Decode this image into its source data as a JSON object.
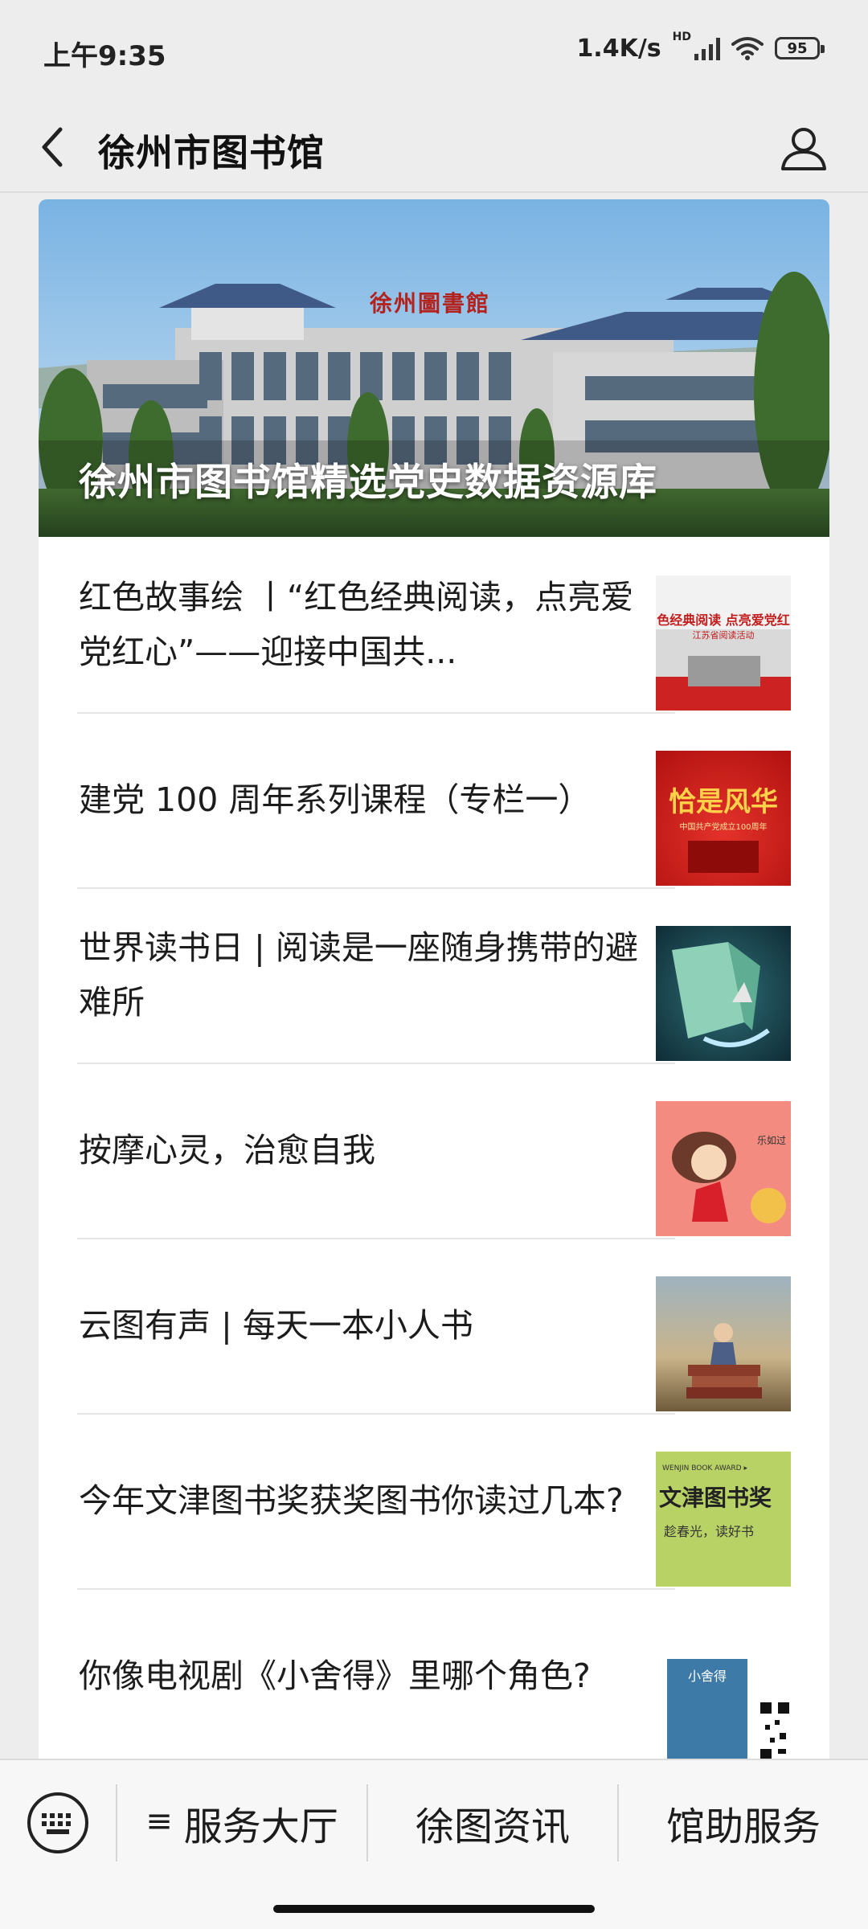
{
  "status_bar": {
    "time": "上午9:35",
    "network_speed": "1.4K/s",
    "network_type": "HD",
    "battery": "95"
  },
  "header": {
    "title": "徐州市图书馆",
    "back_icon": "chevron-left-icon",
    "profile_icon": "user-icon"
  },
  "hero": {
    "title": "徐州市图书馆精选党史数据资源库",
    "sign_text": "徐州圖書館"
  },
  "articles": [
    {
      "title": "红色故事绘 丨“红色经典阅读，点亮爱党红心”——迎接中国共...",
      "thumb": "red-classic-reading-image",
      "thumb_text": "色经典阅读 点亮爱党红",
      "thumb_sub": "江苏省阅读活动"
    },
    {
      "title": "建党 100 周年系列课程（专栏一）",
      "thumb": "party-centenary-image",
      "thumb_text": "恰是风华",
      "thumb_sub": "中国共产党成立100周年"
    },
    {
      "title": "世界读书日 | 阅读是一座随身携带的避难所",
      "thumb": "open-book-ship-image"
    },
    {
      "title": "按摩心灵，治愈自我",
      "thumb": "cartoon-illustration-image",
      "thumb_text": "乐如过"
    },
    {
      "title": "云图有声 | 每天一本小人书",
      "thumb": "girl-on-books-image"
    },
    {
      "title": "今年文津图书奖获奖图书你读过几本?",
      "thumb": "wenjin-book-award-image",
      "thumb_eyebrow": "WENJIN BOOK AWARD ▸",
      "thumb_text": "文津图书奖",
      "thumb_sub": "趁春光，读好书"
    },
    {
      "title": "你像电视剧《小舍得》里哪个角色?",
      "thumb": "xiaoshede-poster-qr-image",
      "thumb_text": "小舍得"
    }
  ],
  "bottom_menu": {
    "keyboard_icon": "keyboard-icon",
    "items": [
      {
        "label": "服务大厅",
        "icon": "≡"
      },
      {
        "label": "徐图资讯"
      },
      {
        "label": "馆助服务"
      }
    ]
  }
}
